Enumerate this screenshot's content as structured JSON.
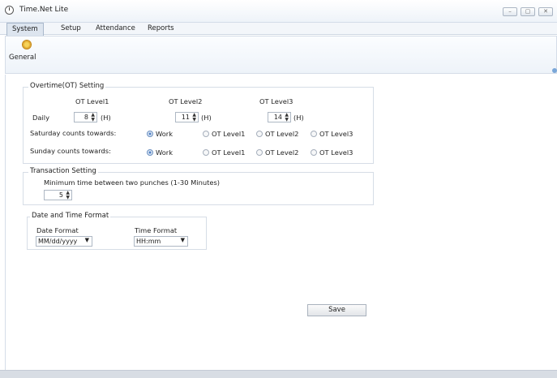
{
  "app": {
    "title": "Time.Net Lite"
  },
  "window_controls": {
    "minimize": "–",
    "maximize": "▢",
    "close": "✕"
  },
  "menu": [
    "System",
    "Setup",
    "Attendance",
    "Reports"
  ],
  "ribbon": {
    "general_label": "General"
  },
  "overtime": {
    "group_title": "Overtime(OT) Setting",
    "levels": [
      "OT Level1",
      "OT Level2",
      "OT Level3"
    ],
    "daily_label": "Daily",
    "daily_values": [
      "8",
      "11",
      "14"
    ],
    "unit": "(H)",
    "saturday_label": "Saturday counts towards:",
    "sunday_label": "Sunday counts towards:",
    "options": [
      "Work",
      "OT Level1",
      "OT Level2",
      "OT Level3"
    ],
    "saturday_selected": "Work",
    "sunday_selected": "Work"
  },
  "transaction": {
    "group_title": "Transaction Setting",
    "min_label": "Minimum time between two punches (1-30 Minutes)",
    "min_value": "5"
  },
  "datetime": {
    "group_title": "Date and Time Format",
    "date_label": "Date Format",
    "date_value": "MM/dd/yyyy",
    "time_label": "Time Format",
    "time_value": "HH:mm"
  },
  "save_label": "Save",
  "glyphs": {
    "spin": "▲\n▼",
    "caret": "▼"
  }
}
